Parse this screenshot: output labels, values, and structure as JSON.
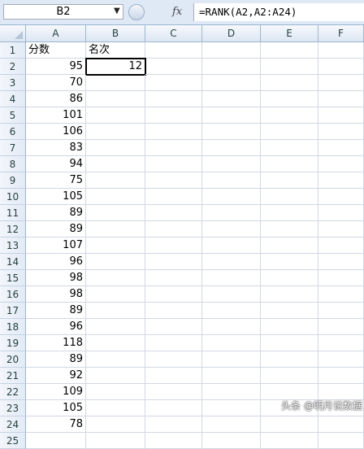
{
  "formula_bar": {
    "name_box": "B2",
    "fx_label": "fx",
    "formula": "=RANK(A2,A2:A24)"
  },
  "columns": [
    "A",
    "B",
    "C",
    "D",
    "E",
    "F"
  ],
  "rows": [
    {
      "n": "1",
      "a": "分数",
      "b": "名次"
    },
    {
      "n": "2",
      "a": "95",
      "b": "12"
    },
    {
      "n": "3",
      "a": "70",
      "b": ""
    },
    {
      "n": "4",
      "a": "86",
      "b": ""
    },
    {
      "n": "5",
      "a": "101",
      "b": ""
    },
    {
      "n": "6",
      "a": "106",
      "b": ""
    },
    {
      "n": "7",
      "a": "83",
      "b": ""
    },
    {
      "n": "8",
      "a": "94",
      "b": ""
    },
    {
      "n": "9",
      "a": "75",
      "b": ""
    },
    {
      "n": "10",
      "a": "105",
      "b": ""
    },
    {
      "n": "11",
      "a": "89",
      "b": ""
    },
    {
      "n": "12",
      "a": "89",
      "b": ""
    },
    {
      "n": "13",
      "a": "107",
      "b": ""
    },
    {
      "n": "14",
      "a": "96",
      "b": ""
    },
    {
      "n": "15",
      "a": "98",
      "b": ""
    },
    {
      "n": "16",
      "a": "98",
      "b": ""
    },
    {
      "n": "17",
      "a": "89",
      "b": ""
    },
    {
      "n": "18",
      "a": "96",
      "b": ""
    },
    {
      "n": "19",
      "a": "118",
      "b": ""
    },
    {
      "n": "20",
      "a": "89",
      "b": ""
    },
    {
      "n": "21",
      "a": "92",
      "b": ""
    },
    {
      "n": "22",
      "a": "109",
      "b": ""
    },
    {
      "n": "23",
      "a": "105",
      "b": ""
    },
    {
      "n": "24",
      "a": "78",
      "b": ""
    },
    {
      "n": "25",
      "a": "",
      "b": ""
    }
  ],
  "watermark": "头条 @明月说数据",
  "colors": {
    "header_bg": "#dce6f3",
    "grid_line": "#d0d7e5",
    "header_border": "#9eb6ce"
  }
}
